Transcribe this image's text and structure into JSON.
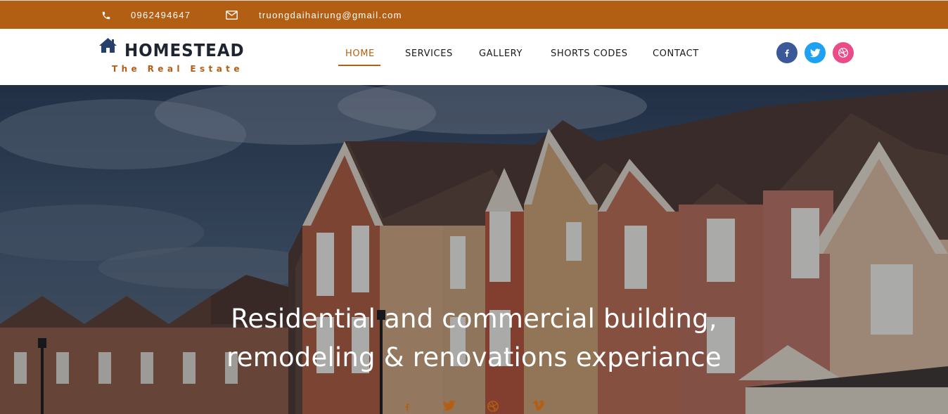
{
  "topbar": {
    "phone_icon": "phone-icon",
    "phone": "0962494647",
    "email_icon": "envelope-icon",
    "email": "truongdaihairung@gmail.com",
    "background": "#b35f13"
  },
  "logo": {
    "icon": "house-icon",
    "name": "HOMESTEAD",
    "tagline": "The Real Estate"
  },
  "nav": {
    "items": [
      {
        "label": "HOME",
        "active": true
      },
      {
        "label": "SERVICES",
        "active": false
      },
      {
        "label": "GALLERY",
        "active": false
      },
      {
        "label": "SHORTS CODES",
        "active": false
      },
      {
        "label": "CONTACT",
        "active": false
      }
    ],
    "accent": "#b35f13"
  },
  "social": [
    {
      "name": "facebook-icon",
      "color": "#3b5998"
    },
    {
      "name": "twitter-icon",
      "color": "#1da1f2"
    },
    {
      "name": "dribbble-icon",
      "color": "#ea4c89"
    }
  ],
  "hero": {
    "headline_line1": "Residential and commercial building,",
    "headline_line2": "remodeling & renovations experiance",
    "social_icons": [
      "facebook-icon",
      "twitter-icon",
      "dribbble-icon",
      "vimeo-icon"
    ],
    "icon_color": "#b35f13"
  }
}
